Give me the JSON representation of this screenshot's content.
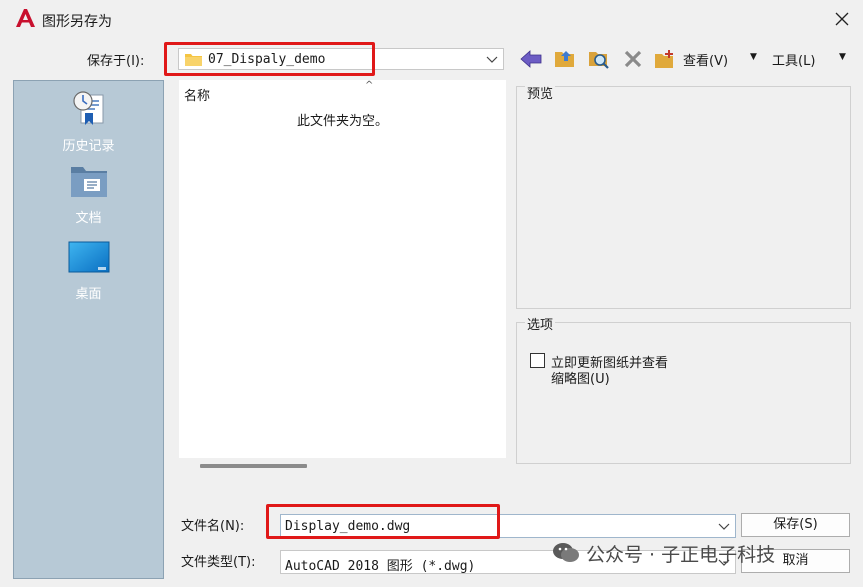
{
  "window": {
    "title": "图形另存为",
    "app_icon": "autocad-a-icon"
  },
  "save_in": {
    "label": "保存于(I):",
    "value": "07_Dispaly_demo"
  },
  "toolbar": {
    "icons": [
      "back-arrow-icon",
      "up-folder-icon",
      "search-web-icon",
      "delete-icon",
      "new-folder-icon"
    ],
    "view_label": "查看(V)",
    "tools_label": "工具(L)"
  },
  "places": [
    {
      "label": "历史记录",
      "icon": "history-icon"
    },
    {
      "label": "文档",
      "icon": "documents-icon"
    },
    {
      "label": "桌面",
      "icon": "desktop-icon"
    }
  ],
  "file_list": {
    "column_name": "名称",
    "empty_message": "此文件夹为空。"
  },
  "preview": {
    "title": "预览"
  },
  "options": {
    "title": "选项",
    "checkbox_line1": "立即更新图纸并查看",
    "checkbox_line2": "缩略图(U)",
    "checked": false
  },
  "file_name": {
    "label": "文件名(N):",
    "value": "Display_demo.dwg"
  },
  "file_type": {
    "label": "文件类型(T):",
    "value": "AutoCAD 2018 图形 (*.dwg)"
  },
  "buttons": {
    "save": "保存(S)",
    "cancel": "取消"
  },
  "watermark": {
    "text": "公众号 · 子正电子科技"
  },
  "colors": {
    "accent_red": "#e01818",
    "places_bg": "#b7c9d6",
    "app_red": "#c8102e"
  }
}
